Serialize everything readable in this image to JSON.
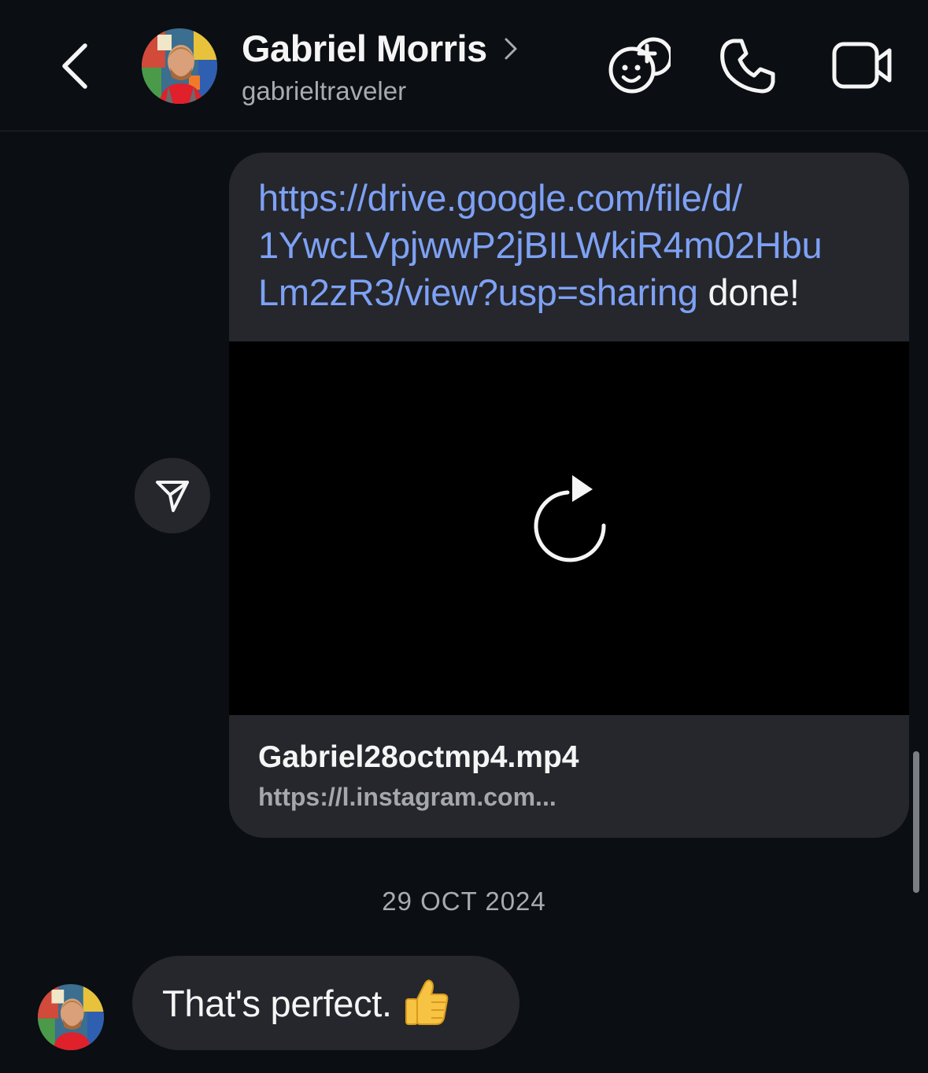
{
  "header": {
    "back_icon": "chevron-left-icon",
    "contact_name": "Gabriel Morris",
    "username": "gabrieltraveler",
    "actions": [
      "effects-icon",
      "phone-icon",
      "video-camera-icon"
    ]
  },
  "messages": {
    "link_message": {
      "link_text": "https://drive.google.com/file/d/1YwcLVpjwwP2jBILWkiR4m02HbuLm2zR3/view?usp=sharing",
      "link_lines": [
        "https://drive.google.com/file/d/",
        "1YwcLVpjwwP2jBILWkiR4m02Hbu",
        "Lm2zR3/view?usp=sharing"
      ],
      "trailing_text": " done!"
    },
    "attachment": {
      "file_name": "Gabriel28octmp4.mp4",
      "url": "https://l.instagram.com..."
    },
    "date_separator": "29 OCT 2024",
    "received": {
      "text": "That's perfect.",
      "emoji": "thumbs-up"
    }
  },
  "colors": {
    "background": "#0b0e12",
    "bubble": "#25272c",
    "link": "#7ea1f5",
    "secondary_text": "#a8abb1"
  }
}
